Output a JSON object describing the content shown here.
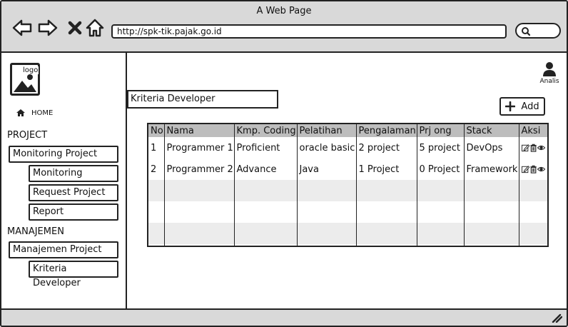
{
  "window": {
    "title": "A Web Page"
  },
  "browser": {
    "url": "http://spk-tik.pajak.go.id",
    "icons": [
      "back-arrow-icon",
      "forward-arrow-icon",
      "close-x-icon",
      "home-icon",
      "search-icon"
    ]
  },
  "sidebar": {
    "logo_text": "logo",
    "home_label": "HOME",
    "project_section": "PROJECT",
    "monitoring_project": "Monitoring Project",
    "monitoring": "Monitoring",
    "request_project": "Request Project",
    "report": "Report",
    "manajemen_section": "MANAJEMEN",
    "manajemen_project": "Manajemen Project",
    "kriteria_developer": "Kriteria Developer"
  },
  "header": {
    "user_label": "Analis"
  },
  "main": {
    "page_title": "Kriteria Developer",
    "add_label": "Add",
    "table": {
      "columns": [
        "No",
        "Nama",
        "Kmp. Coding",
        "Pelatihan",
        "Pengalaman",
        "Prj ong",
        "Stack",
        "Aksi"
      ],
      "rows": [
        [
          "1",
          "Programmer 1",
          "Proficient",
          "oracle basic",
          "2 project",
          "5 project",
          "DevOps"
        ],
        [
          "2",
          "Programmer 2",
          "Advance",
          "Java",
          "1 Project",
          "0 Project",
          "Framework"
        ]
      ],
      "action_icons": [
        "edit-icon",
        "delete-icon",
        "view-icon"
      ]
    }
  },
  "colors": {
    "chrome": "#d9d9d9",
    "header_row": "#bdbdbd",
    "stripe": "#ececec",
    "stroke": "#222222"
  }
}
